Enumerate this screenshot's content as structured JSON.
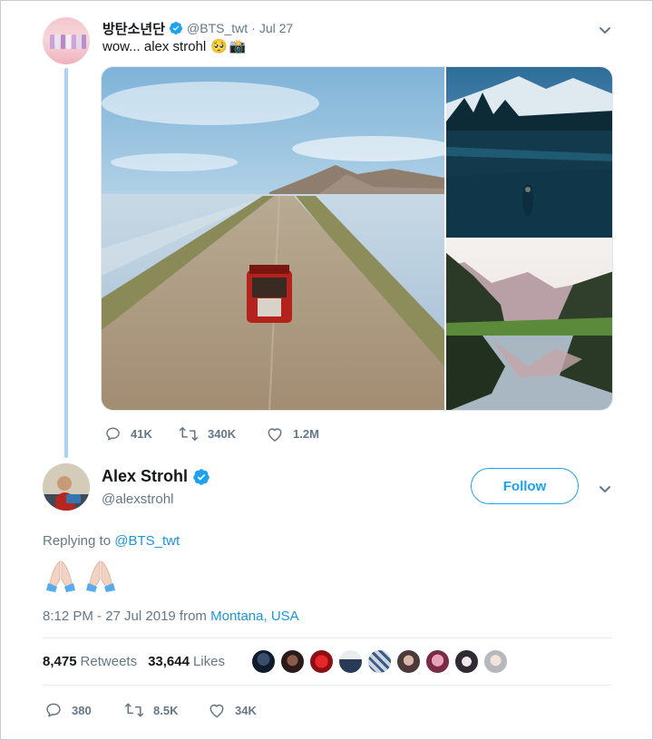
{
  "parent_tweet": {
    "display_name": "방탄소년단",
    "handle": "@BTS_twt",
    "date": "Jul 27",
    "text": "wow... alex strohl",
    "emoji": [
      "🥺",
      "📸"
    ],
    "stats": {
      "replies": "41K",
      "retweets": "340K",
      "likes": "1.2M"
    }
  },
  "main_tweet": {
    "display_name": "Alex Strohl",
    "handle": "@alexstrohl",
    "follow_label": "Follow",
    "replying_prefix": "Replying to",
    "replying_to": "@BTS_twt",
    "emoji": [
      "🙏",
      "🙏"
    ],
    "timestamp": "8:12 PM - 27 Jul 2019 from",
    "location": "Montana, USA",
    "retweets_count": "8,475",
    "retweets_label": "Retweets",
    "likes_count": "33,644",
    "likes_label": "Likes",
    "action_stats": {
      "replies": "380",
      "retweets": "8.5K",
      "likes": "34K"
    }
  },
  "icons": [
    "verified-badge-icon",
    "chevron-down-icon",
    "reply-icon",
    "retweet-icon",
    "like-icon"
  ],
  "colors": {
    "accent": "#1da1f2",
    "link": "#1b95e0",
    "secondary": "#657786",
    "thread": "#a9d3f3"
  }
}
